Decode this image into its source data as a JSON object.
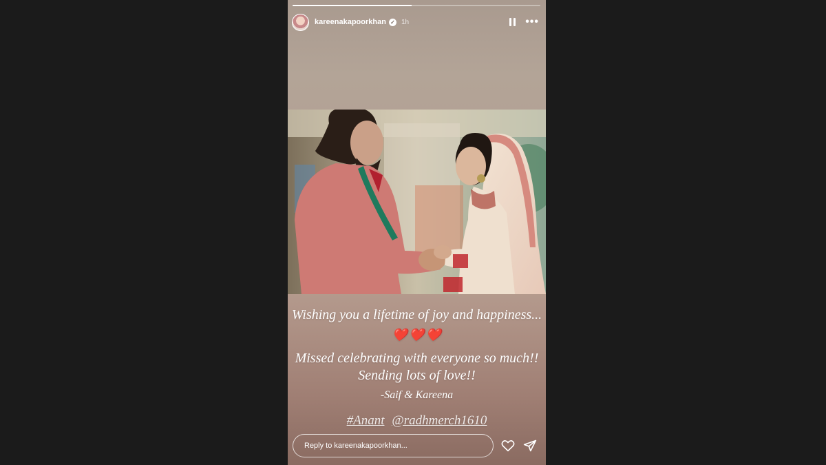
{
  "story": {
    "progress": [
      0.48
    ],
    "user": {
      "username": "kareenakapoorkhan",
      "time": "1h",
      "verified_icon": "verified-badge-icon"
    },
    "controls": {
      "pause_icon": "pause-icon",
      "more_icon": "more-icon"
    },
    "caption": {
      "line1": "Wishing you a lifetime of joy and happiness...",
      "hearts": [
        "❤️",
        "❤️",
        "❤️"
      ],
      "line2": "Missed celebrating with everyone so much!!",
      "line3": "Sending lots of love!!",
      "signature": "-Saif & Kareena",
      "tag_hashtag": "#Anant",
      "tag_mention": "@radhmerch1610"
    },
    "reply": {
      "placeholder": "Reply to kareenakapoorkhan...",
      "like_icon": "heart-icon",
      "send_icon": "send-icon"
    }
  },
  "colors": {
    "page_bg": "#1b1b1b",
    "story_bg": "#b3a497",
    "heart": "#e0202a"
  }
}
